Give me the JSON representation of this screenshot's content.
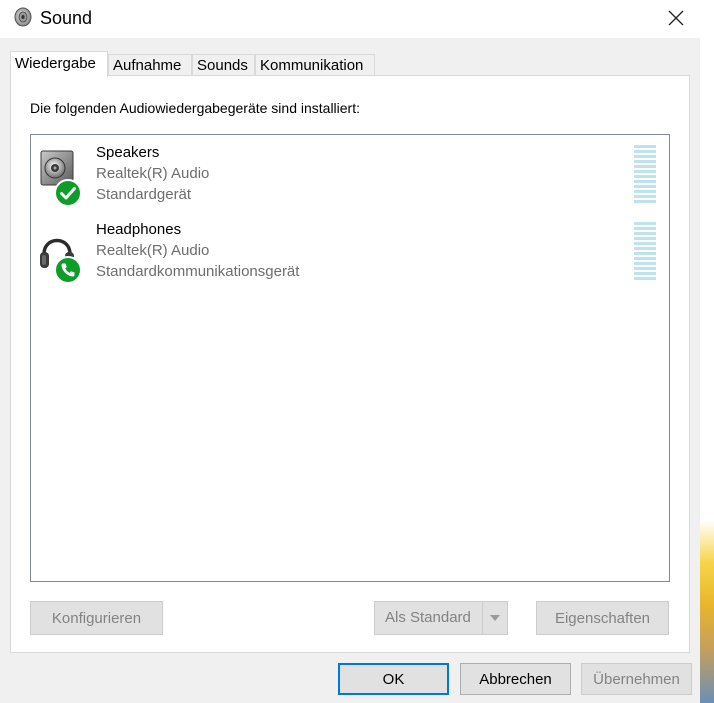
{
  "window": {
    "title": "Sound",
    "icon": "speaker-icon"
  },
  "tabs": [
    {
      "label": "Wiedergabe",
      "active": true
    },
    {
      "label": "Aufnahme",
      "active": false
    },
    {
      "label": "Sounds",
      "active": false
    },
    {
      "label": "Kommunikation",
      "active": false
    }
  ],
  "playback": {
    "label": "Die folgenden Audiowiedergabegeräte sind installiert:",
    "devices": [
      {
        "name": "Speakers",
        "driver": "Realtek(R) Audio",
        "status": "Standardgerät",
        "icon": "speaker-icon",
        "badge": "checkmark-icon"
      },
      {
        "name": "Headphones",
        "driver": "Realtek(R) Audio",
        "status": "Standardkommunikationsgerät",
        "icon": "headphones-icon",
        "badge": "phone-icon"
      }
    ],
    "buttons": {
      "configure": "Konfigurieren",
      "set_default": "Als Standard",
      "properties": "Eigenschaften"
    }
  },
  "footer": {
    "ok": "OK",
    "cancel": "Abbrechen",
    "apply": "Übernehmen"
  },
  "colors": {
    "accent": "#0078d7",
    "badge_green": "#0f9d2a",
    "meter": "#bfe3ec"
  }
}
